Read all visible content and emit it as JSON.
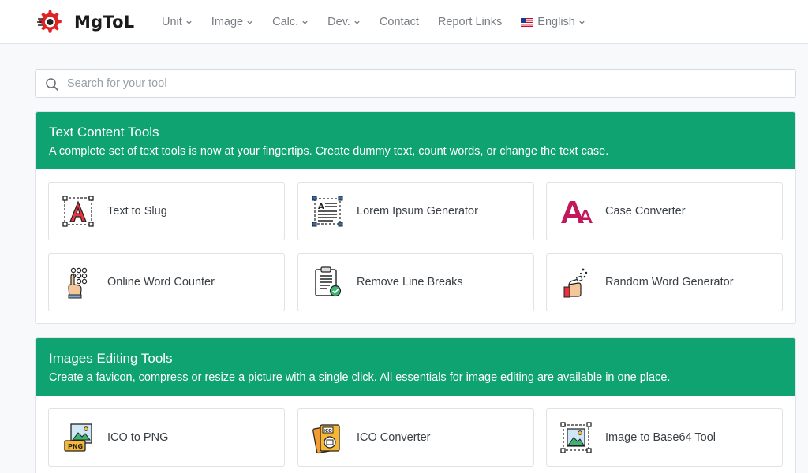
{
  "brand": {
    "name": "MgToL",
    "color": "#e02424"
  },
  "nav": {
    "items": [
      {
        "label": "Unit",
        "dropdown": true
      },
      {
        "label": "Image",
        "dropdown": true
      },
      {
        "label": "Calc.",
        "dropdown": true
      },
      {
        "label": "Dev.",
        "dropdown": true
      },
      {
        "label": "Contact",
        "dropdown": false
      },
      {
        "label": "Report Links",
        "dropdown": false
      }
    ],
    "language": {
      "label": "English",
      "icon": "us-flag-icon"
    }
  },
  "search": {
    "placeholder": "Search for your tool",
    "value": ""
  },
  "accent": "#10a372",
  "sections": [
    {
      "title": "Text Content Tools",
      "description": "A complete set of text tools is now at your fingertips. Create dummy text, count words, or change the text case.",
      "tools": [
        {
          "label": "Text to Slug",
          "icon": "text-slug-icon"
        },
        {
          "label": "Lorem Ipsum Generator",
          "icon": "lorem-ipsum-icon"
        },
        {
          "label": "Case Converter",
          "icon": "case-converter-icon"
        },
        {
          "label": "Online Word Counter",
          "icon": "word-counter-icon"
        },
        {
          "label": "Remove Line Breaks",
          "icon": "remove-line-breaks-icon"
        },
        {
          "label": "Random Word Generator",
          "icon": "random-word-icon"
        }
      ]
    },
    {
      "title": "Images Editing Tools",
      "description": "Create a favicon, compress or resize a picture with a single click. All essentials for image editing are available in one place.",
      "tools": [
        {
          "label": "ICO to PNG",
          "icon": "ico-to-png-icon"
        },
        {
          "label": "ICO Converter",
          "icon": "ico-converter-icon"
        },
        {
          "label": "Image to Base64 Tool",
          "icon": "image-base64-icon"
        }
      ]
    }
  ]
}
